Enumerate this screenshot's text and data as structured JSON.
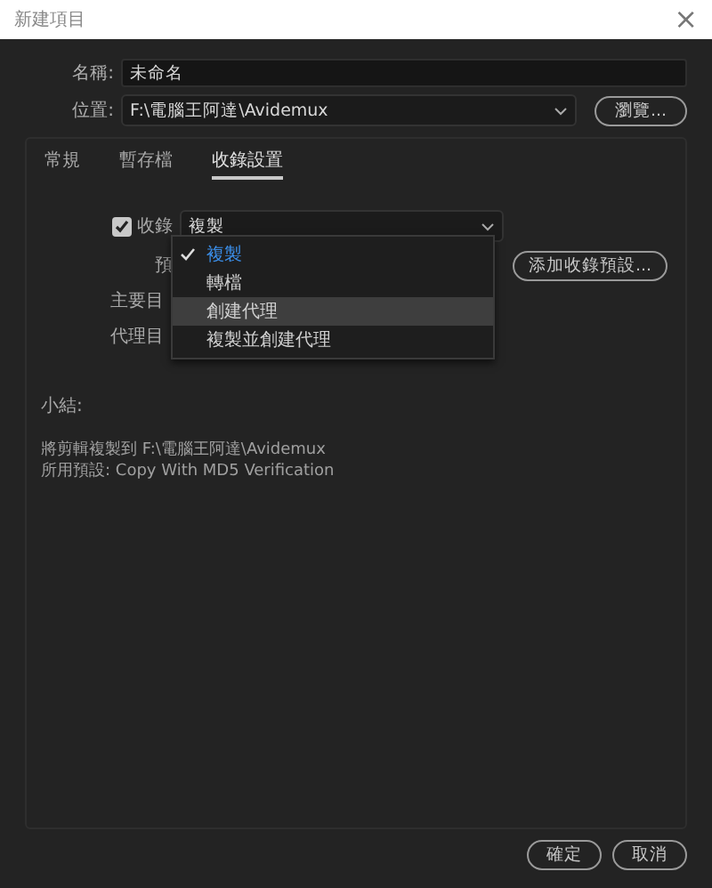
{
  "window": {
    "title": "新建項目",
    "close": "×"
  },
  "name_field": {
    "label": "名稱:",
    "value": "未命名"
  },
  "location_field": {
    "label": "位置:",
    "value": "F:\\電腦王阿達\\Avidemux",
    "browse_button": "瀏覽..."
  },
  "tabs": [
    {
      "label": "常規",
      "selected": false
    },
    {
      "label": "暫存檔",
      "selected": false
    },
    {
      "label": "收錄設置",
      "selected": true
    }
  ],
  "ingest": {
    "label": "收錄",
    "checked": true,
    "value": "複製",
    "preset_label": "預",
    "primary_label": "主要目",
    "proxy_label": "代理目",
    "add_preset_button": "添加收錄預設..."
  },
  "dropdown_menu": [
    {
      "label": "複製",
      "selected": true,
      "hovered": false
    },
    {
      "label": "轉檔",
      "selected": false,
      "hovered": false
    },
    {
      "label": "創建代理",
      "selected": false,
      "hovered": true
    },
    {
      "label": "複製並創建代理",
      "selected": false,
      "hovered": false
    }
  ],
  "summary": {
    "title": "小結:",
    "lines": [
      {
        "label": "將剪輯複製到",
        "value": "F:\\電腦王阿達\\Avidemux"
      },
      {
        "label": "所用預設:",
        "value": "Copy With MD5 Verification"
      }
    ]
  },
  "buttons": [
    "確定",
    "取消"
  ]
}
